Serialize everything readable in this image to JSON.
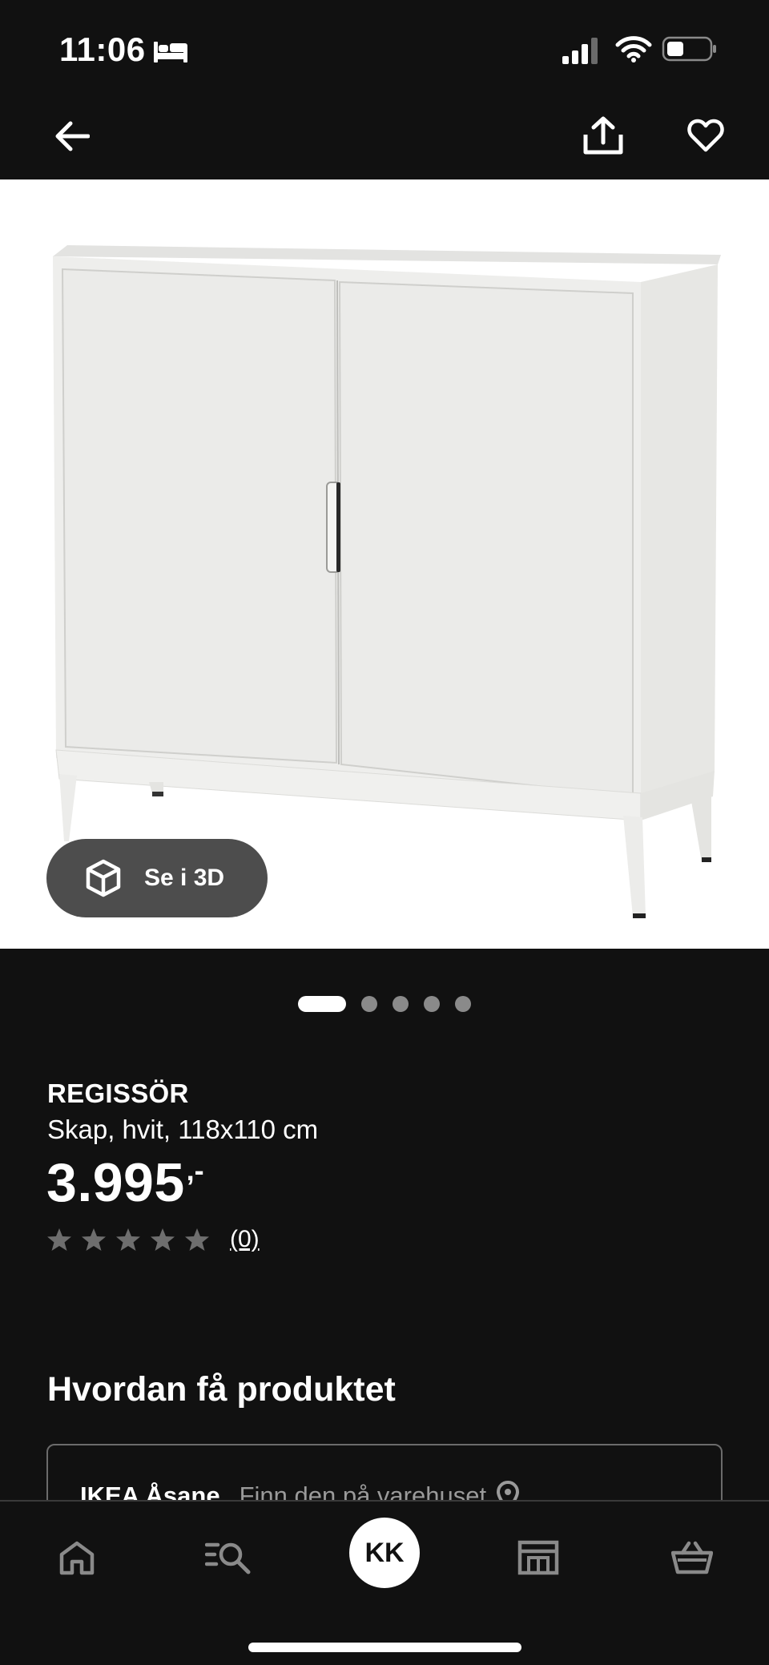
{
  "status_bar": {
    "time": "11:06",
    "icons": [
      "bed-icon",
      "signal-icon",
      "wifi-icon",
      "battery-icon"
    ]
  },
  "nav": {
    "icons": [
      "back-arrow-icon",
      "share-icon",
      "heart-icon"
    ]
  },
  "gallery": {
    "view_3d_label": "Se i 3D",
    "total_images": 5,
    "active_index": 0
  },
  "product": {
    "name": "REGISSÖR",
    "description": "Skap, hvit, 118x110 cm",
    "price": "3.995",
    "price_suffix": ",-",
    "rating": 0,
    "rating_max": 5,
    "review_count": "(0)"
  },
  "availability": {
    "title": "Hvordan få produktet",
    "store_name": "IKEA Åsane",
    "store_link": "Finn den på varehuset"
  },
  "tab_bar": {
    "profile_initials": "KK",
    "icons": [
      "home-icon",
      "search-list-icon",
      "profile-avatar",
      "store-icon",
      "cart-icon"
    ]
  },
  "colors": {
    "background": "#111111",
    "text": "#ffffff",
    "muted": "#9a9a9a",
    "button_3d": "#4d4d4d",
    "product_bg": "#ffffff"
  }
}
